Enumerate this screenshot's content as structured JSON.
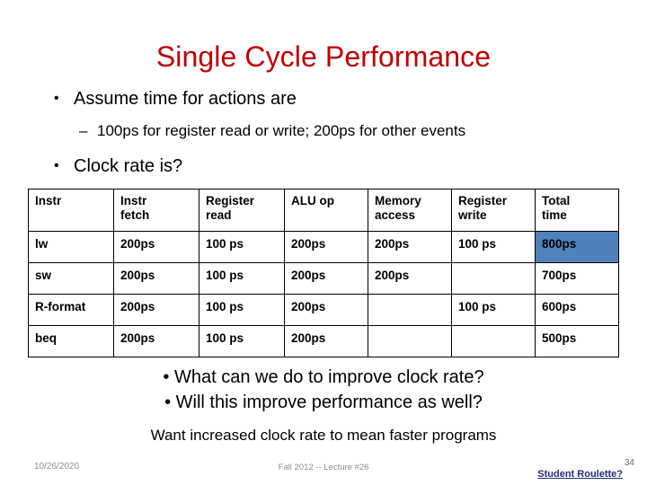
{
  "slide": {
    "title": "Single Cycle Performance",
    "title_color": "#C00000",
    "background": "#ffffff"
  },
  "bullets_top": [
    {
      "level": 1,
      "marker": "•",
      "text": "Assume time for actions are"
    },
    {
      "level": 2,
      "marker": "–",
      "text": "100ps for register read or write; 200ps for other events"
    },
    {
      "level": 1,
      "marker": "•",
      "text": "Clock rate is?"
    }
  ],
  "table": {
    "headers": [
      {
        "line1": "Instr",
        "line2": ""
      },
      {
        "line1": "Instr",
        "line2": "fetch"
      },
      {
        "line1": "Register",
        "line2": "read"
      },
      {
        "line1": "ALU op",
        "line2": ""
      },
      {
        "line1": "Memory",
        "line2": "access"
      },
      {
        "line1": "Register",
        "line2": "write"
      },
      {
        "line1": "Total",
        "line2": "time"
      }
    ],
    "rows": [
      {
        "cells": [
          "lw",
          "200ps",
          "100 ps",
          "200ps",
          "200ps",
          "100 ps",
          "800ps"
        ],
        "highlight_index": 6
      },
      {
        "cells": [
          "sw",
          "200ps",
          "100 ps",
          "200ps",
          "200ps",
          "",
          "700ps"
        ],
        "highlight_index": -1
      },
      {
        "cells": [
          "R-format",
          "200ps",
          "100 ps",
          "200ps",
          "",
          "100 ps",
          "600ps"
        ],
        "highlight_index": -1
      },
      {
        "cells": [
          "beq",
          "200ps",
          "100 ps",
          "200ps",
          "",
          "",
          "500ps"
        ],
        "highlight_index": -1
      }
    ],
    "highlight_color": "#4F81BD",
    "border_color": "#000000"
  },
  "bullets_bottom": [
    {
      "marker": "•",
      "text": "What can we do to improve clock rate?"
    },
    {
      "marker": "•",
      "text": "Will this improve performance as well?"
    }
  ],
  "bottom_note": "Want increased clock rate to mean faster programs",
  "footer": {
    "date": "10/26/2020",
    "center": "Fall 2012 -- Lecture #26",
    "link": "Student Roulette?",
    "link_color": "#1F2D77",
    "page_number": "34"
  }
}
